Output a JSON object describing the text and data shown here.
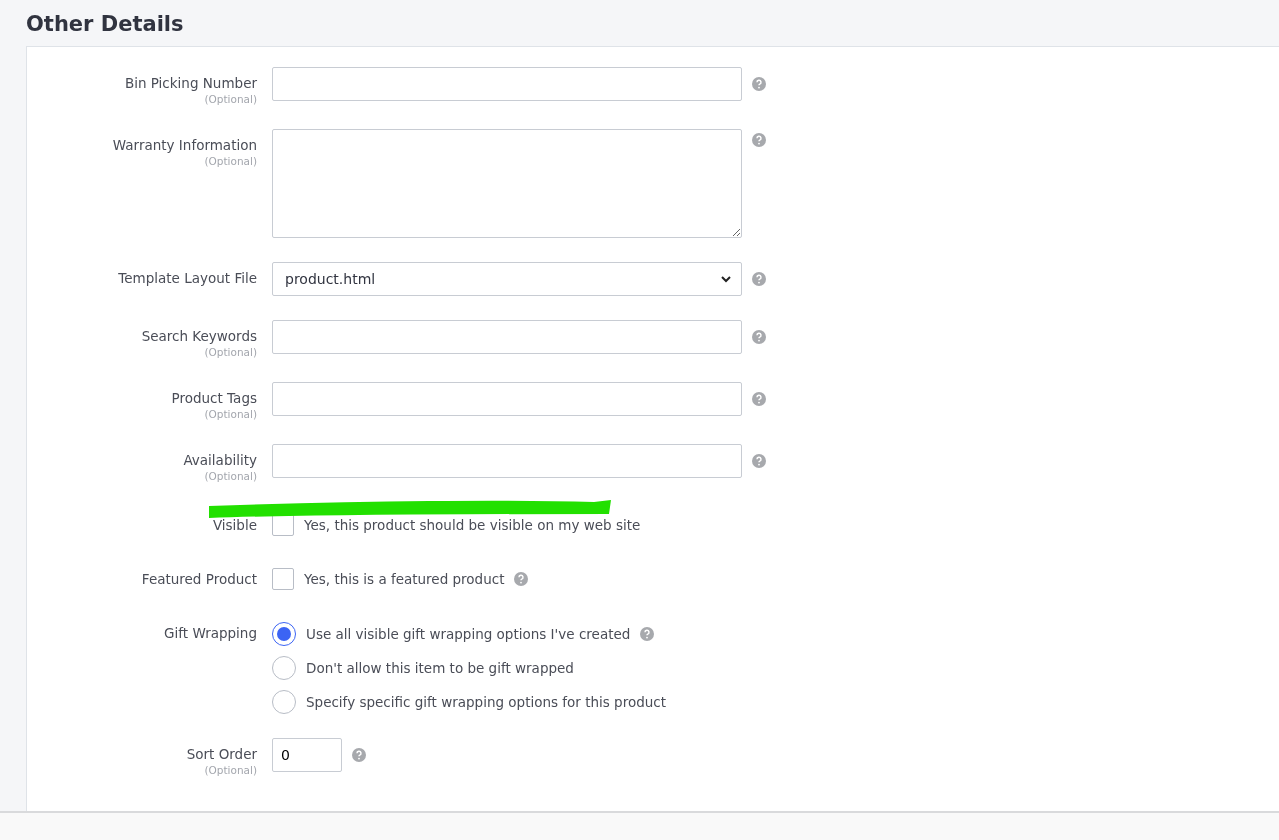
{
  "section": {
    "title": "Other Details"
  },
  "fields": [
    {
      "kind": "text",
      "label": "Bin Picking Number",
      "note": "(Optional)",
      "help": true
    },
    {
      "kind": "textarea",
      "label": "Warranty Information",
      "note": "(Optional)",
      "help": true
    },
    {
      "kind": "select",
      "label": "Template Layout File",
      "value": "product.html",
      "help": true
    },
    {
      "kind": "text",
      "label": "Search Keywords",
      "note": "(Optional)",
      "help": true
    },
    {
      "kind": "text",
      "label": "Product Tags",
      "note": "(Optional)",
      "help": true
    },
    {
      "kind": "text",
      "label": "Availability",
      "note": "(Optional)",
      "help": true
    },
    {
      "kind": "checkbox",
      "label": "Visible",
      "text": "Yes, this product should be visible on my web site",
      "checked": false,
      "help": false,
      "highlighted": true
    },
    {
      "kind": "checkbox",
      "label": "Featured Product",
      "text": "Yes, this is a featured product",
      "checked": false,
      "help": true
    },
    {
      "kind": "radio",
      "label": "Gift Wrapping",
      "options": [
        {
          "text": "Use all visible gift wrapping options I've created",
          "selected": true,
          "help": true
        },
        {
          "text": "Don't allow this item to be gift wrapped",
          "selected": false,
          "help": false
        },
        {
          "text": "Specify specific gift wrapping options for this product",
          "selected": false,
          "help": false
        }
      ]
    },
    {
      "kind": "small",
      "label": "Sort Order",
      "note": "(Optional)",
      "value": "0",
      "help": true
    }
  ]
}
